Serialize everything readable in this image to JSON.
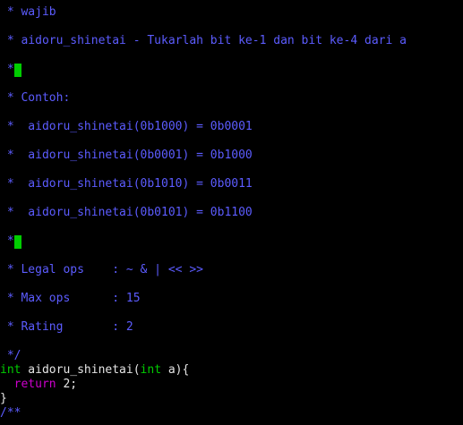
{
  "editor": {
    "comment_lines": [
      {
        "text": " * wajib"
      },
      {
        "text": " * aidoru_shinetai - Tukarlah bit ke-1 dan bit ke-4 dari a"
      },
      {
        "text": " *",
        "cursor": true
      },
      {
        "text": " * Contoh:"
      },
      {
        "text": " *  aidoru_shinetai(0b1000) = 0b0001"
      },
      {
        "text": " *  aidoru_shinetai(0b0001) = 0b1000"
      },
      {
        "text": " *  aidoru_shinetai(0b1010) = 0b0011"
      },
      {
        "text": " *  aidoru_shinetai(0b0101) = 0b1100"
      },
      {
        "text": " *",
        "cursor": true
      },
      {
        "text": " * Legal ops    : ~ & | << >>"
      },
      {
        "text": " * Max ops      : 15"
      },
      {
        "text": " * Rating       : 2"
      }
    ],
    "comment_end": " */",
    "code": {
      "type_int": "int",
      "func_name": " aidoru_shinetai(",
      "param_type": "int",
      "param_rest": " a){",
      "return_indent": "  ",
      "return_kw": "return",
      "return_value": " 2;",
      "close_brace": "}"
    },
    "next_comment": "/**"
  },
  "colors": {
    "background": "#000000",
    "comment": "#5c5cff",
    "type": "#00cd00",
    "keyword": "#cd00cd",
    "text": "#e5e5e5",
    "cursor": "#00cd00"
  }
}
